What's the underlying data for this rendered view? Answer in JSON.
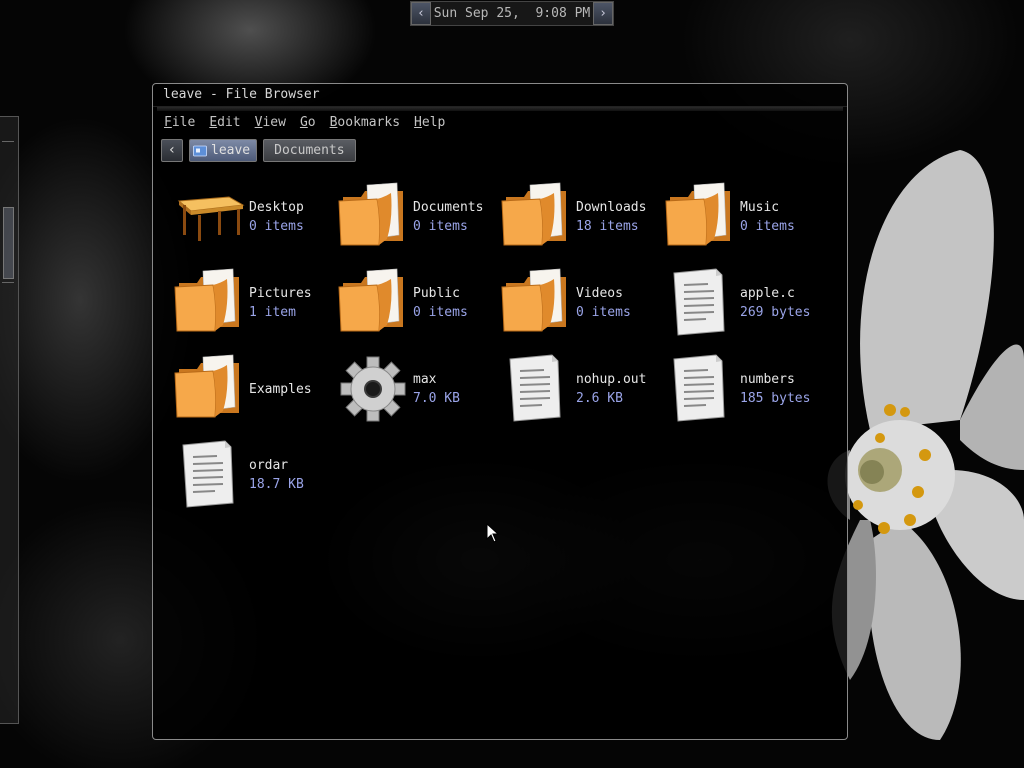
{
  "panel": {
    "clock": "Sun Sep 25,  9:08 PM",
    "prev_glyph": "‹",
    "next_glyph": "›"
  },
  "window": {
    "title": "leave - File Browser",
    "menu": [
      {
        "mnemonic": "F",
        "rest": "ile"
      },
      {
        "mnemonic": "E",
        "rest": "dit"
      },
      {
        "mnemonic": "V",
        "rest": "iew"
      },
      {
        "mnemonic": "G",
        "rest": "o"
      },
      {
        "mnemonic": "B",
        "rest": "ookmarks"
      },
      {
        "mnemonic": "H",
        "rest": "elp"
      }
    ],
    "path": {
      "back_glyph": "‹",
      "crumbs": [
        "leave",
        "Documents"
      ]
    }
  },
  "files": [
    {
      "name": "Desktop",
      "meta": "0 items",
      "icon": "desk-icon"
    },
    {
      "name": "Documents",
      "meta": "0 items",
      "icon": "folder-icon"
    },
    {
      "name": "Downloads",
      "meta": "18 items",
      "icon": "folder-icon"
    },
    {
      "name": "Music",
      "meta": "0 items",
      "icon": "folder-icon"
    },
    {
      "name": "Pictures",
      "meta": "1 item",
      "icon": "folder-icon"
    },
    {
      "name": "Public",
      "meta": "0 items",
      "icon": "folder-icon"
    },
    {
      "name": "Videos",
      "meta": "0 items",
      "icon": "folder-icon"
    },
    {
      "name": "apple.c",
      "meta": "269 bytes",
      "icon": "text-file-icon"
    },
    {
      "name": "Examples",
      "meta": "",
      "icon": "folder-icon"
    },
    {
      "name": "max",
      "meta": "7.0 KB",
      "icon": "executable-gear-icon"
    },
    {
      "name": "nohup.out",
      "meta": "2.6 KB",
      "icon": "text-file-icon"
    },
    {
      "name": "numbers",
      "meta": "185 bytes",
      "icon": "text-file-icon"
    },
    {
      "name": "ordar",
      "meta": "18.7 KB",
      "icon": "text-file-icon"
    }
  ],
  "colors": {
    "folder": "#f0a045",
    "meta_text": "#9aa4e8",
    "active_crumb": "#6a7896"
  }
}
